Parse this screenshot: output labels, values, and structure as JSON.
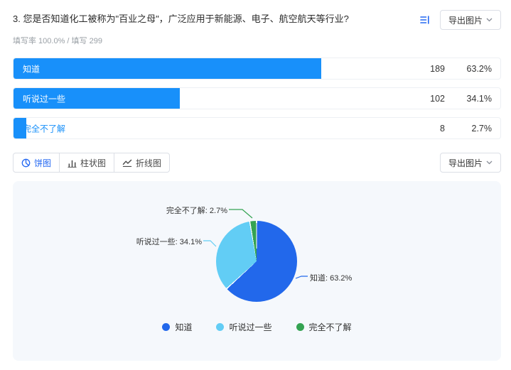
{
  "header": {
    "title": "3. 您是否知道化工被称为\"百业之母\"，广泛应用于新能源、电子、航空航天等行业?",
    "stats": "填写率 100.0% / 填写 299",
    "export_label": "导出图片"
  },
  "toolbar": {
    "export_label": "导出图片",
    "tabs": [
      {
        "label": "饼图",
        "icon": "pie-chart-icon",
        "active": true
      },
      {
        "label": "柱状图",
        "icon": "bar-chart-icon",
        "active": false
      },
      {
        "label": "折线图",
        "icon": "line-chart-icon",
        "active": false
      }
    ]
  },
  "options": [
    {
      "label": "知道",
      "count": "189",
      "percent": "63.2%",
      "value": 63.2
    },
    {
      "label": "听说过一些",
      "count": "102",
      "percent": "34.1%",
      "value": 34.1
    },
    {
      "label": "完全不了解",
      "count": "8",
      "percent": "2.7%",
      "value": 2.7
    }
  ],
  "colors": {
    "bar": "#1890FA",
    "accent": "#2468F2",
    "panel_bg": "#F5F8FC"
  },
  "chart_data": {
    "type": "pie",
    "labels": [
      "知道",
      "听说过一些",
      "完全不了解"
    ],
    "values": [
      63.2,
      34.1,
      2.7
    ],
    "counts": [
      189,
      102,
      8
    ],
    "unit": "%",
    "colors": [
      "#2268EB",
      "#62CDF5",
      "#34A352"
    ],
    "annotations": [
      "知道: 63.2%",
      "听说过一些: 34.1%",
      "完全不了解: 2.7%"
    ],
    "legend": [
      "知道",
      "听说过一些",
      "完全不了解"
    ],
    "legend_position": "bottom",
    "start_angle_deg": 0,
    "direction": "clockwise"
  }
}
